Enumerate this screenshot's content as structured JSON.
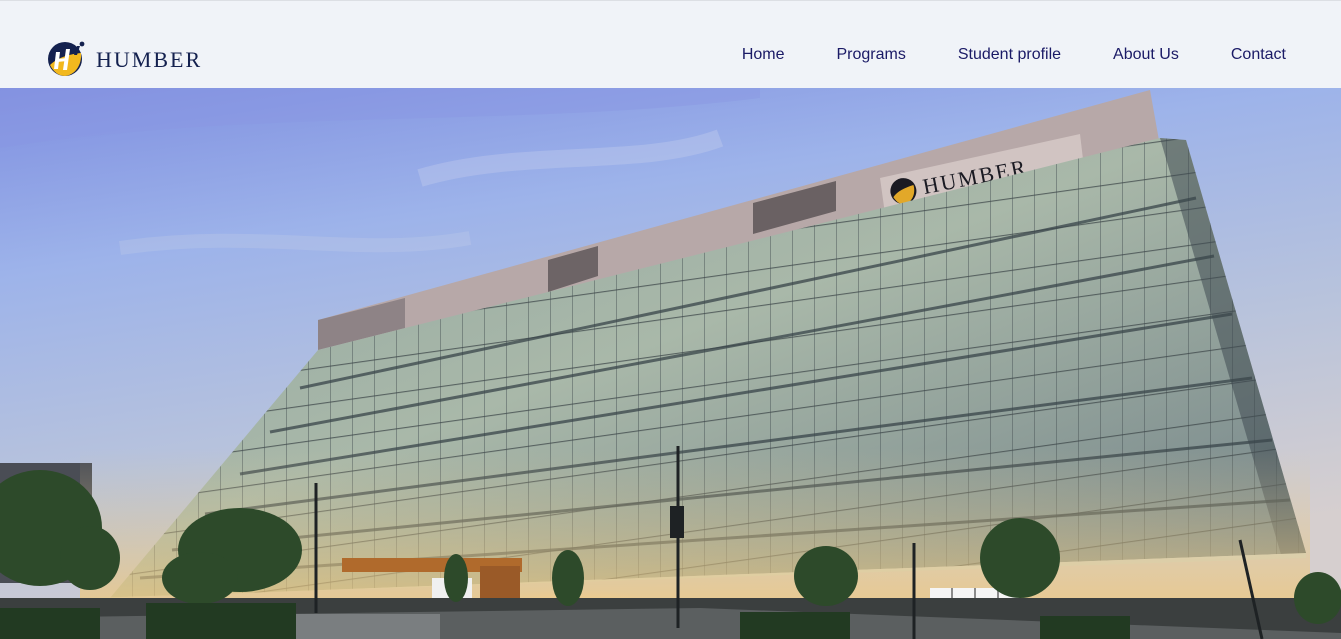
{
  "brand": {
    "name": "HUMBER",
    "colors": {
      "navy": "#14214f",
      "gold": "#f2b81e",
      "link": "#1a1a66"
    }
  },
  "nav": {
    "items": [
      {
        "label": "Home"
      },
      {
        "label": "Programs"
      },
      {
        "label": "Student profile"
      },
      {
        "label": "About Us"
      },
      {
        "label": "Contact"
      }
    ]
  },
  "hero": {
    "building_sign": "HUMBER"
  }
}
